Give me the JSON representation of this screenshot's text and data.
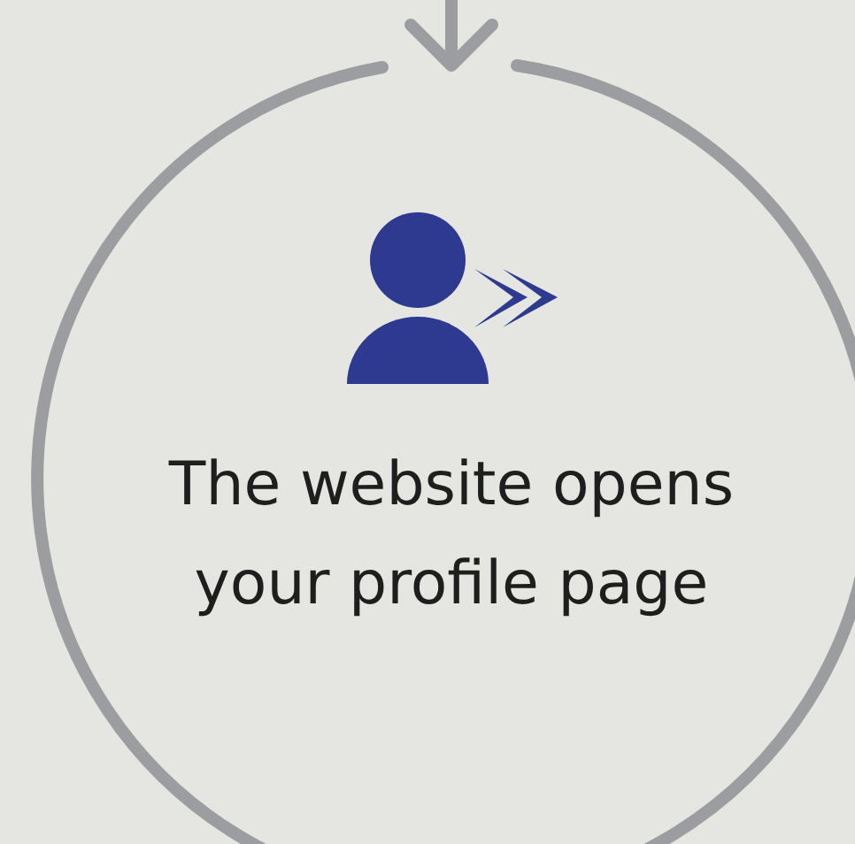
{
  "step": {
    "text": "The website opens your profile page"
  }
}
